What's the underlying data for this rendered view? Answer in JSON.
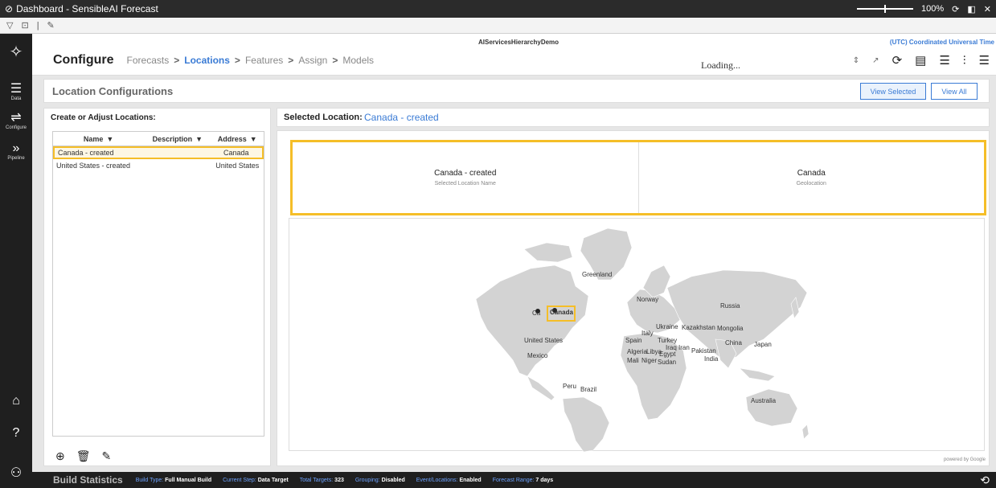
{
  "window": {
    "title": "Dashboard - SensibleAI Forecast",
    "zoom": "100%"
  },
  "header": {
    "hierarchy": "AIServicesHierarchyDemo",
    "timezone": "(UTC) Coordinated Universal Time",
    "configure": "Configure",
    "steps": [
      "Forecasts",
      "Locations",
      "Features",
      "Assign",
      "Models"
    ],
    "active_step": "Locations",
    "loading": "Loading..."
  },
  "rail": {
    "items": [
      {
        "label": "Data",
        "icon": "database-icon"
      },
      {
        "label": "Configure",
        "icon": "sliders-icon"
      },
      {
        "label": "Pipeline",
        "icon": "chevrons-icon"
      }
    ]
  },
  "section": {
    "title": "Location Configurations",
    "view_selected": "View Selected",
    "view_all": "View All"
  },
  "left_panel": {
    "title": "Create or Adjust Locations:",
    "columns": [
      "Name",
      "Description",
      "Address"
    ],
    "rows": [
      {
        "name": "Canada - created",
        "description": "",
        "address": "Canada"
      },
      {
        "name": "United States - created",
        "description": "",
        "address": "United States"
      }
    ]
  },
  "right_panel": {
    "label": "Selected Location:",
    "value": "Canada - created",
    "cards": [
      {
        "main": "Canada - created",
        "sub": "Selected Location Name"
      },
      {
        "main": "Canada",
        "sub": "Geolocation"
      }
    ],
    "map_labels": {
      "greenland": "Greenland",
      "canada": "Canada",
      "canada_clipped": "Ca",
      "usa": "United States",
      "mexico": "Mexico",
      "peru": "Peru",
      "brazil": "Brazil",
      "norway": "Norway",
      "russia": "Russia",
      "ukraine": "Ukraine",
      "kazakhstan": "Kazakhstan",
      "mongolia": "Mongolia",
      "italy": "Italy",
      "spain": "Spain",
      "turkey": "Turkey",
      "iraq": "Iraq",
      "iran": "Iran",
      "pakistan": "Pakistan",
      "china": "China",
      "japan": "Japan",
      "algeria": "Algeria",
      "libya": "Libya",
      "egypt": "Egypt",
      "india": "India",
      "mali": "Mali",
      "niger": "Niger",
      "sudan": "Sudan",
      "australia": "Australia"
    },
    "powered_by": "powered by Google"
  },
  "status": {
    "title": "Build Statistics",
    "items": [
      {
        "k": "Build Type:",
        "v": "Full Manual Build"
      },
      {
        "k": "Current Step:",
        "v": "Data Target"
      },
      {
        "k": "Total Targets:",
        "v": "323"
      },
      {
        "k": "Grouping:",
        "v": "Disabled"
      },
      {
        "k": "Event/Locations:",
        "v": "Enabled"
      },
      {
        "k": "Forecast Range:",
        "v": "7 days"
      }
    ]
  }
}
